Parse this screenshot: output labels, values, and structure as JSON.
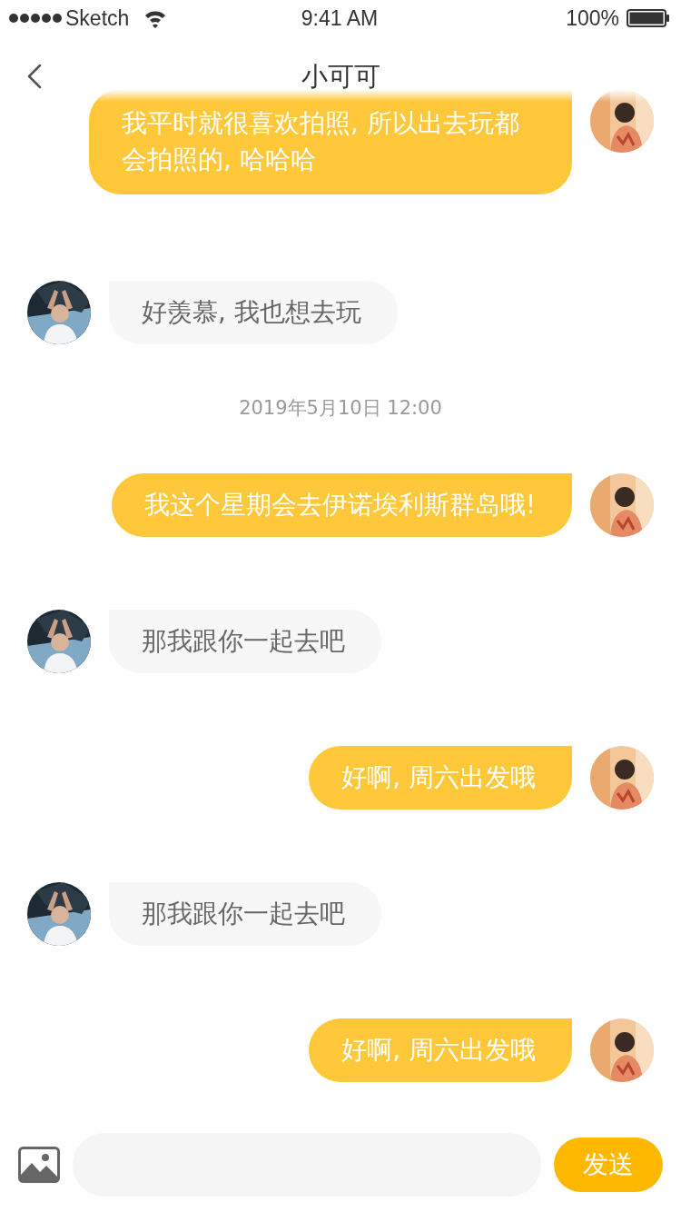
{
  "status_bar": {
    "carrier": "Sketch",
    "time": "9:41 AM",
    "battery": "100%"
  },
  "nav": {
    "title": "小可可"
  },
  "messages": [
    {
      "kind": "sent",
      "text": "我平时就很喜欢拍照, 所以出去玩都会拍照的, 哈哈哈"
    },
    {
      "kind": "received",
      "text": "好羡慕, 我也想去玩"
    },
    {
      "kind": "timestamp",
      "text": "2019年5月10日 12:00"
    },
    {
      "kind": "sent",
      "text": "我这个星期会去伊诺埃利斯群岛哦!"
    },
    {
      "kind": "received",
      "text": "那我跟你一起去吧"
    },
    {
      "kind": "sent",
      "text": "好啊, 周六出发哦"
    },
    {
      "kind": "received",
      "text": "那我跟你一起去吧"
    },
    {
      "kind": "sent",
      "text": "好啊, 周六出发哦"
    }
  ],
  "composer": {
    "send": "发送"
  }
}
